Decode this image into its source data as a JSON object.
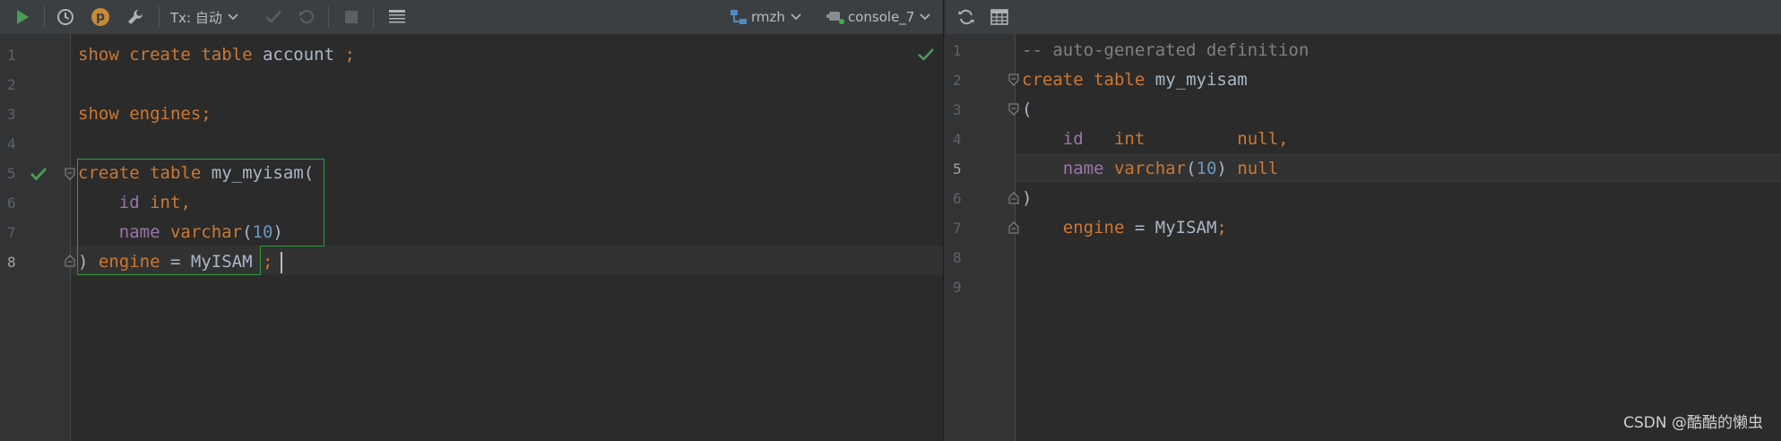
{
  "left_toolbar": {
    "run_icon": "play-icon",
    "history_icon": "clock-icon",
    "profile_badge": "p",
    "settings_icon": "wrench-icon",
    "tx_label": "Tx: 自动",
    "commit_icon": "check-icon",
    "rollback_icon": "undo-icon",
    "stop_icon": "stop-icon",
    "results_icon": "table-lines-icon",
    "schema_label": "rmzh",
    "console_label": "console_7"
  },
  "right_toolbar": {
    "refresh_icon": "refresh-icon",
    "grid_icon": "table-icon"
  },
  "left_editor": {
    "line_numbers": [
      "1",
      "2",
      "3",
      "4",
      "5",
      "6",
      "7",
      "8"
    ],
    "active_line": "8",
    "lines": {
      "l1": {
        "show": "show",
        "create": "create",
        "table": "table",
        "name": "account",
        "semi": ";"
      },
      "l3": {
        "show": "show",
        "engines": "engines",
        "semi": ";"
      },
      "l5": {
        "create": "create",
        "table": "table",
        "name": "my_myisam",
        "paren": "("
      },
      "l6": {
        "col": "id",
        "type": "int",
        "comma": ","
      },
      "l7": {
        "col": "name",
        "type": "varchar",
        "open": "(",
        "num": "10",
        "close": ")"
      },
      "l8": {
        "close": ")",
        "engine": "engine",
        "eq": "=",
        "value": "MyISAM",
        "semi": ";"
      }
    }
  },
  "right_editor": {
    "line_numbers": [
      "1",
      "2",
      "3",
      "4",
      "5",
      "6",
      "7",
      "8",
      "9"
    ],
    "active_line": "5",
    "lines": {
      "l1": {
        "comment": "-- auto-generated definition"
      },
      "l2": {
        "create": "create",
        "table": "table",
        "name": "my_myisam"
      },
      "l3": {
        "paren": "("
      },
      "l4": {
        "col": "id",
        "type": "int",
        "nullkw": "null",
        "comma": ","
      },
      "l5": {
        "col": "name",
        "type": "varchar",
        "open": "(",
        "num": "10",
        "close": ")",
        "nullkw": "null"
      },
      "l6": {
        "paren": ")"
      },
      "l7": {
        "engine": "engine",
        "eq": "=",
        "value": "MyISAM",
        "semi": ";"
      }
    }
  },
  "watermark": "CSDN @酷酷的懒虫",
  "colors": {
    "keyword": "#cc7832",
    "number": "#6897bb",
    "column": "#9876aa",
    "comment": "#808080",
    "success_green": "#499c54",
    "selection_border": "#2e9e3a"
  }
}
